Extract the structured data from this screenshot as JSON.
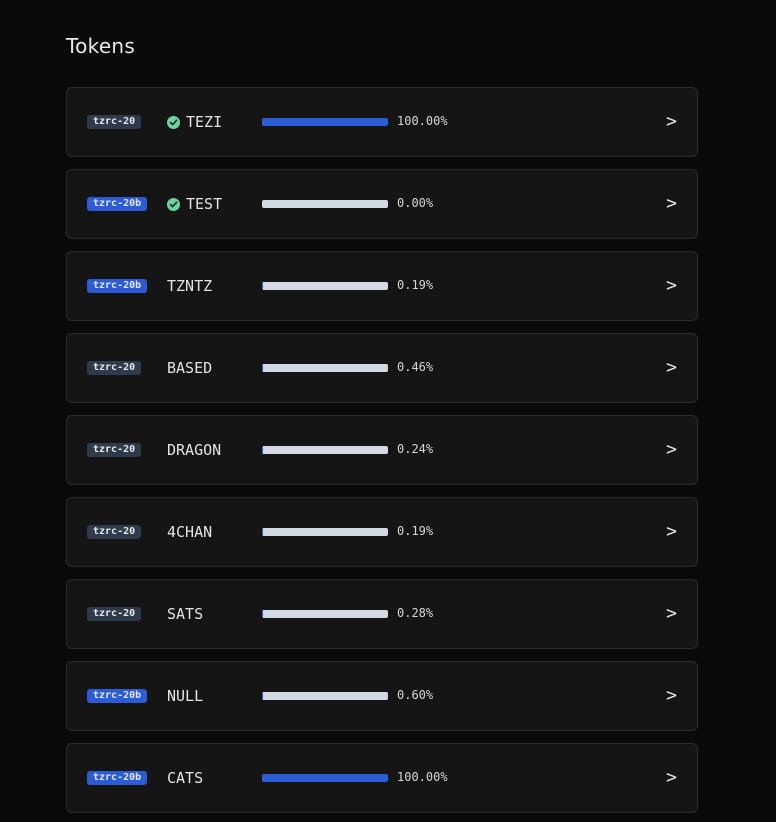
{
  "page": {
    "title": "Tokens"
  },
  "colors": {
    "accent": "#2c5bd6",
    "verified": "#6fd3a0",
    "track": "#d3d9e3"
  },
  "tokens": [
    {
      "type": "tzrc-20",
      "name": "TEZI",
      "verified": true,
      "percent_label": "100.00%",
      "progress": 100.0
    },
    {
      "type": "tzrc-20b",
      "name": "TEST",
      "verified": true,
      "percent_label": "0.00%",
      "progress": 0.0
    },
    {
      "type": "tzrc-20b",
      "name": "TZNTZ",
      "verified": false,
      "percent_label": "0.19%",
      "progress": 0.19
    },
    {
      "type": "tzrc-20",
      "name": "BASED",
      "verified": false,
      "percent_label": "0.46%",
      "progress": 0.46
    },
    {
      "type": "tzrc-20",
      "name": "DRAGON",
      "verified": false,
      "percent_label": "0.24%",
      "progress": 0.24
    },
    {
      "type": "tzrc-20",
      "name": "4CHAN",
      "verified": false,
      "percent_label": "0.19%",
      "progress": 0.19
    },
    {
      "type": "tzrc-20",
      "name": "SATS",
      "verified": false,
      "percent_label": "0.28%",
      "progress": 0.28
    },
    {
      "type": "tzrc-20b",
      "name": "NULL",
      "verified": false,
      "percent_label": "0.60%",
      "progress": 0.6
    },
    {
      "type": "tzrc-20b",
      "name": "CATS",
      "verified": false,
      "percent_label": "100.00%",
      "progress": 100.0
    }
  ],
  "row_action": {
    "chevron": ">",
    "icon": "chevron-right-icon"
  }
}
